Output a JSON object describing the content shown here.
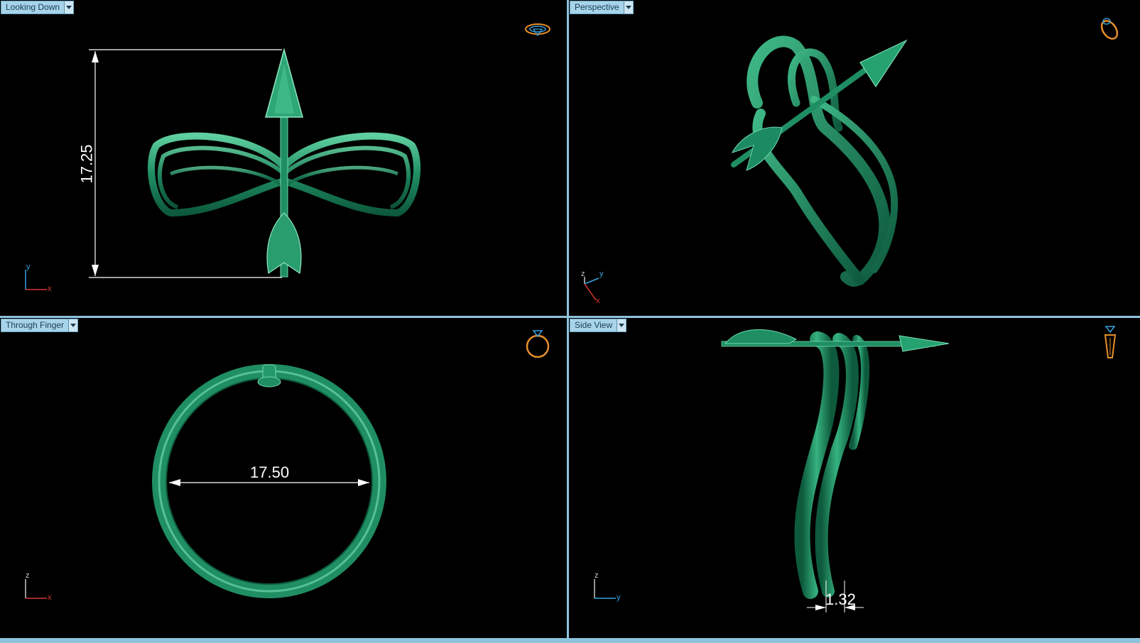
{
  "viewports": {
    "top_left": {
      "label": "Looking Down",
      "dimension": "17.25",
      "axes": [
        "y",
        "x"
      ]
    },
    "top_right": {
      "label": "Perspective",
      "axes": [
        "z",
        "y",
        "x"
      ]
    },
    "bottom_left": {
      "label": "Through Finger",
      "dimension": "17.50",
      "axes": [
        "z",
        "x"
      ]
    },
    "bottom_right": {
      "label": "Side View",
      "dimension": "1.32",
      "axes": [
        "z",
        "y"
      ]
    }
  },
  "icons": {
    "top_left": "ring-top-view-icon",
    "top_right": "ring-perspective-icon",
    "bottom_left": "ring-front-view-icon",
    "bottom_right": "ring-side-view-icon"
  },
  "colors": {
    "model_green": "#1e8f66",
    "model_highlight": "#6fd6ad",
    "viewport_bg": "#000000",
    "tab_bg": "#a7d4ea",
    "border": "#8fc3dc",
    "icon_orange": "#e8902a",
    "axis_x": "#d9392e",
    "axis_y": "#3aa0dd",
    "axis_z": "#c7c7c7"
  }
}
